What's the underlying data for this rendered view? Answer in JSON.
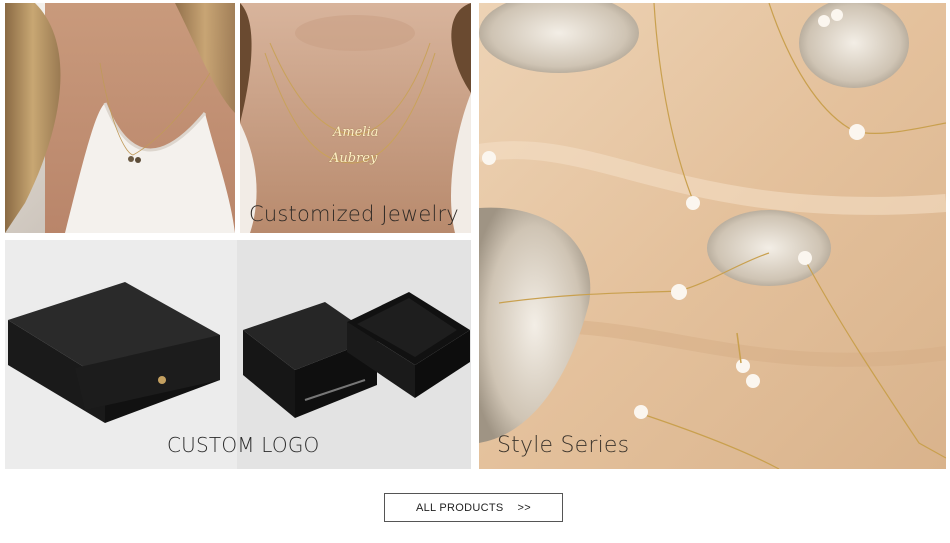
{
  "tiles": {
    "customized": {
      "caption": "Customized Jewelry",
      "name_top": "Amelia",
      "name_bottom": "Aubrey"
    },
    "boxes": {
      "caption": "CUSTOM LOGO"
    },
    "style": {
      "caption": "Style Series"
    }
  },
  "cta": {
    "label": "ALL PRODUCTS",
    "arrows": ">>"
  }
}
